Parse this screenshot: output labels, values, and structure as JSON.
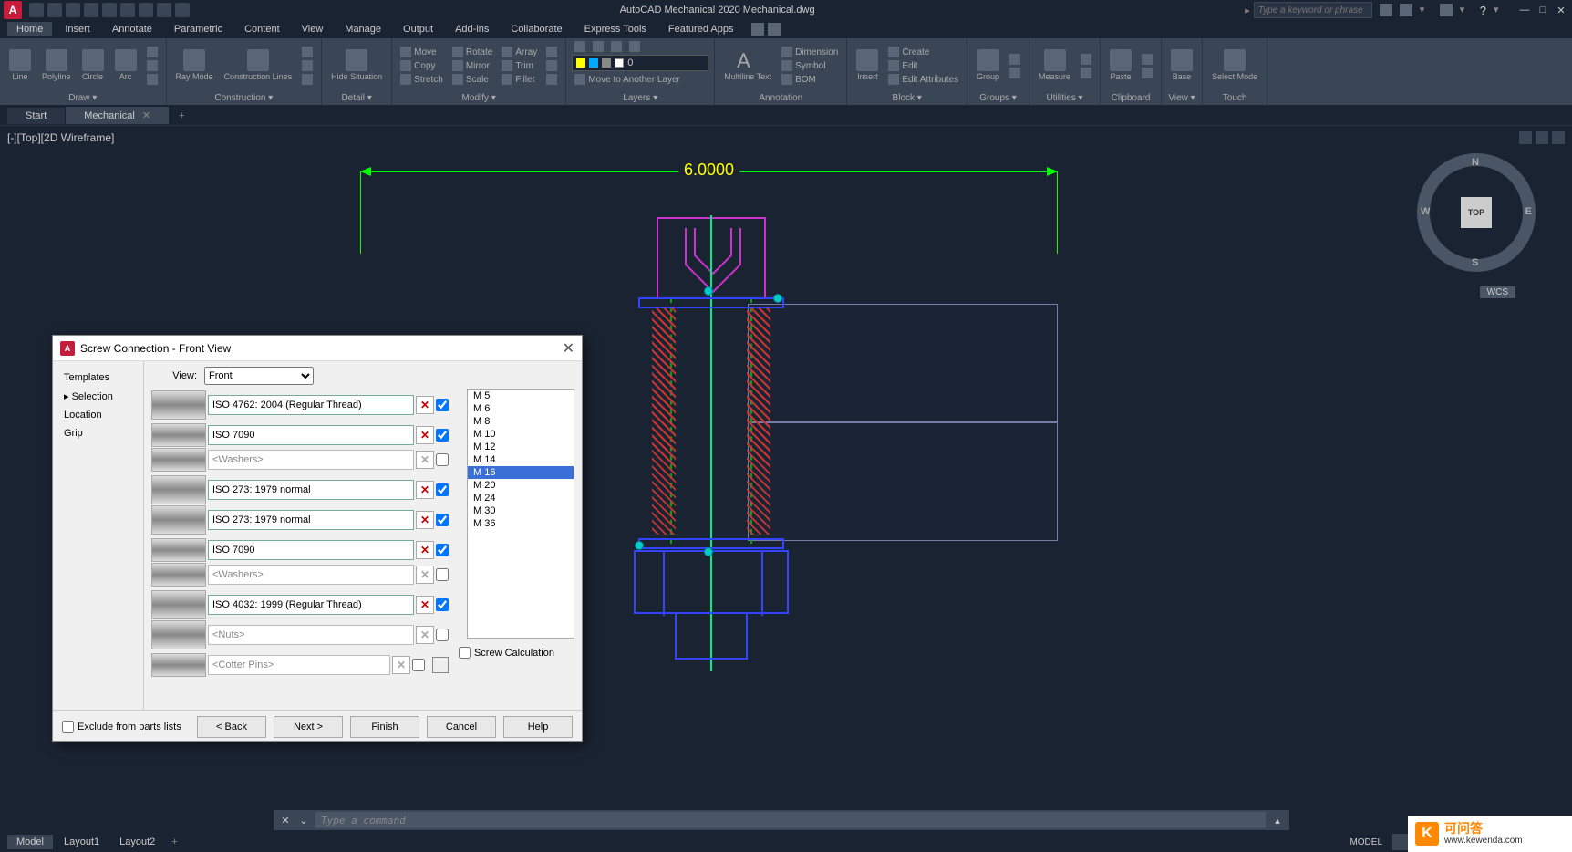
{
  "app": {
    "title": "AutoCAD Mechanical 2020    Mechanical.dwg",
    "search_placeholder": "Type a keyword or phrase"
  },
  "menu_tabs": [
    "Home",
    "Insert",
    "Annotate",
    "Parametric",
    "Content",
    "View",
    "Manage",
    "Output",
    "Add-ins",
    "Collaborate",
    "Express Tools",
    "Featured Apps"
  ],
  "ribbon": {
    "draw": {
      "title": "Draw ▾",
      "items": [
        "Line",
        "Polyline",
        "Circle",
        "Arc"
      ]
    },
    "construction": {
      "title": "Construction ▾",
      "items": [
        "Ray Mode",
        "Construction Lines"
      ]
    },
    "detail": {
      "title": "Detail ▾",
      "items": [
        "Hide Situation"
      ]
    },
    "modify": {
      "title": "Modify ▾",
      "items": [
        "Move",
        "Copy",
        "Stretch",
        "Rotate",
        "Mirror",
        "Scale",
        "Array",
        "Trim",
        "Fillet"
      ]
    },
    "layers": {
      "title": "Layers ▾",
      "current": "0",
      "move_label": "Move to Another Layer"
    },
    "annotation": {
      "title": "Annotation",
      "items": [
        "Multiline Text",
        "Dimension",
        "Symbol",
        "BOM"
      ]
    },
    "block": {
      "title": "Block ▾",
      "items": [
        "Insert",
        "Create",
        "Edit",
        "Edit Attributes"
      ]
    },
    "groups": {
      "title": "Groups ▾",
      "item": "Group"
    },
    "utilities": {
      "title": "Utilities ▾",
      "item": "Measure"
    },
    "clipboard": {
      "title": "Clipboard",
      "item": "Paste"
    },
    "view": {
      "title": "View ▾",
      "item": "Base"
    },
    "touch": {
      "title": "Touch",
      "item": "Select Mode"
    }
  },
  "file_tabs": {
    "start": "Start",
    "active": "Mechanical"
  },
  "viewport": {
    "label": "[-][Top][2D Wireframe]",
    "viewcube": {
      "top": "TOP",
      "n": "N",
      "s": "S",
      "e": "E",
      "w": "W"
    },
    "wcs": "WCS",
    "dimension_value": "6.0000"
  },
  "dialog": {
    "title": "Screw Connection - Front View",
    "steps": [
      "Templates",
      "Selection",
      "Location",
      "Grip"
    ],
    "active_step": "Selection",
    "view_label": "View:",
    "view_value": "Front",
    "parts": [
      {
        "name": "ISO 4762: 2004 (Regular Thread)",
        "removable": true,
        "checked": true
      },
      {
        "name": "ISO 7090",
        "removable": true,
        "checked": true
      },
      {
        "name": "<Washers>",
        "removable": false,
        "checked": false,
        "grey": true
      },
      {
        "name": "ISO 273: 1979 normal",
        "removable": true,
        "checked": true
      },
      {
        "name": "ISO 273: 1979 normal",
        "removable": true,
        "checked": true
      },
      {
        "name": "ISO 7090",
        "removable": true,
        "checked": true
      },
      {
        "name": "<Washers>",
        "removable": false,
        "checked": false,
        "grey": true
      },
      {
        "name": "ISO 4032: 1999 (Regular Thread)",
        "removable": true,
        "checked": true
      },
      {
        "name": "<Nuts>",
        "removable": false,
        "checked": false,
        "grey": true
      },
      {
        "name": "<Cotter Pins>",
        "removable": false,
        "checked": false,
        "grey": true
      }
    ],
    "sizes": [
      "M 5",
      "M 6",
      "M 8",
      "M 10",
      "M 12",
      "M 14",
      "M 16",
      "M 20",
      "M 24",
      "M 30",
      "M 36"
    ],
    "selected_size": "M 16",
    "screw_calc_label": "Screw Calculation",
    "exclude_label": "Exclude from parts lists",
    "buttons": {
      "back": "< Back",
      "next": "Next >",
      "finish": "Finish",
      "cancel": "Cancel",
      "help": "Help"
    }
  },
  "cmdline": {
    "prompt": "Type a command"
  },
  "status": {
    "tabs": [
      "Model",
      "Layout1",
      "Layout2"
    ],
    "model": "MODEL"
  },
  "watermark": {
    "main": "可问答",
    "sub": "www.kewenda.com"
  }
}
